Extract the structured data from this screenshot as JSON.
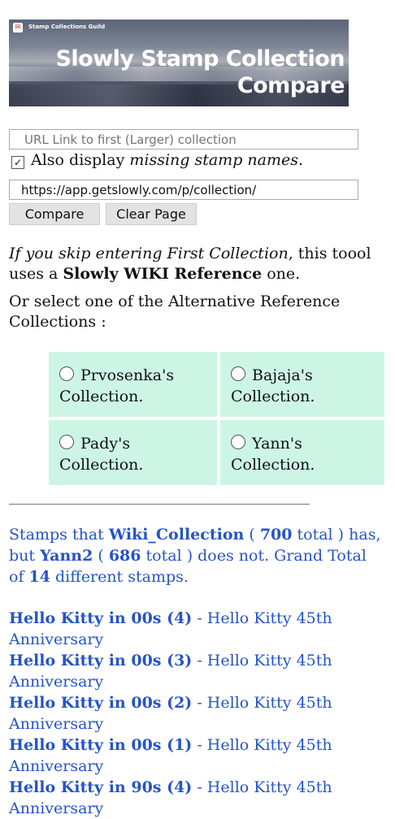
{
  "banner": {
    "guild": "Stamp Collections Guild",
    "title_line1": "Slowly Stamp Collection",
    "title_line2": "Compare",
    "logo_icon": "envelope-icon"
  },
  "form": {
    "first_placeholder": "URL Link to first (Larger) collection",
    "checkbox_checked": true,
    "checkbox_prefix": "Also display ",
    "checkbox_em": "missing stamp names",
    "checkbox_suffix": ".",
    "second_value": "https://app.getslowly.com/p/collection/",
    "compare_label": "Compare",
    "clear_label": "Clear Page"
  },
  "info": {
    "p1_em": "If you skip entering First Collection",
    "p1_mid": ", this toool uses a ",
    "p1_bold": "Slowly WIKI Reference",
    "p1_end": " one.",
    "p2": "Or select one of the Alternative Reference Collections :"
  },
  "options": [
    {
      "name": "Prvosenka's",
      "suffix": "Collection."
    },
    {
      "name": "Bajaja's",
      "suffix": "Collection."
    },
    {
      "name": "Pady's",
      "suffix": "Collection."
    },
    {
      "name": "Yann's",
      "suffix": "Collection."
    }
  ],
  "summary": {
    "t1": "Stamps that ",
    "col1": "Wiki_Collection",
    "t2": " ( ",
    "n1": "700",
    "t3": " total ) has, but ",
    "col2": "Yann2",
    "t4": " ( ",
    "n2": "686",
    "t5": " total ) does not. Grand Total of ",
    "n3": "14",
    "t6": " different stamps."
  },
  "stamps": [
    {
      "name": "Hello Kitty in 00s (4)",
      "set": " - Hello Kitty 45th Anniversary"
    },
    {
      "name": "Hello Kitty in 00s (3)",
      "set": " - Hello Kitty 45th Anniversary"
    },
    {
      "name": "Hello Kitty in 00s (2)",
      "set": " - Hello Kitty 45th Anniversary"
    },
    {
      "name": "Hello Kitty in 00s (1)",
      "set": " - Hello Kitty 45th Anniversary"
    },
    {
      "name": "Hello Kitty in 90s (4)",
      "set": " - Hello Kitty 45th Anniversary"
    }
  ]
}
